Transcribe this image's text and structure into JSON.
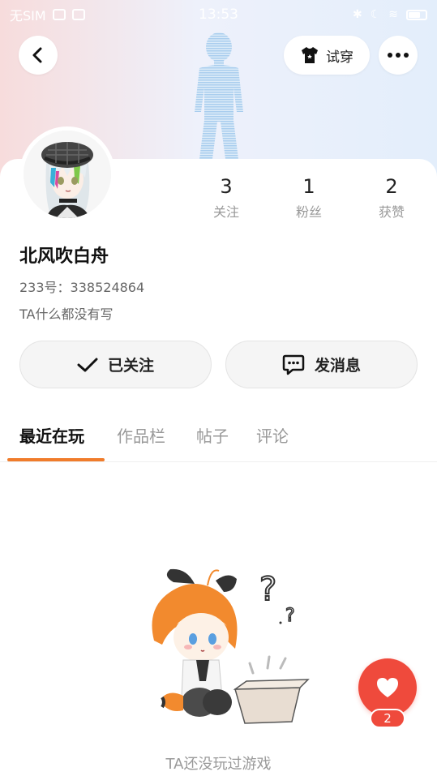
{
  "status_bar": {
    "carrier": "无SIM",
    "time": "13:53"
  },
  "header": {
    "tryon_label": "试穿"
  },
  "profile": {
    "username": "北风吹白舟",
    "user_id": "233号：338524864",
    "bio": "TA什么都没有写",
    "stats": [
      {
        "value": "3",
        "label": "关注"
      },
      {
        "value": "1",
        "label": "粉丝"
      },
      {
        "value": "2",
        "label": "获赞"
      }
    ]
  },
  "actions": {
    "follow_label": "已关注",
    "message_label": "发消息"
  },
  "tabs": [
    {
      "label": "最近在玩",
      "active": true
    },
    {
      "label": "作品栏",
      "active": false
    },
    {
      "label": "帖子",
      "active": false
    },
    {
      "label": "评论",
      "active": false
    }
  ],
  "empty_state": {
    "text": "TA还没玩过游戏"
  },
  "like": {
    "count": "2"
  },
  "colors": {
    "accent": "#f07c2b",
    "like": "#ef4a3c"
  }
}
